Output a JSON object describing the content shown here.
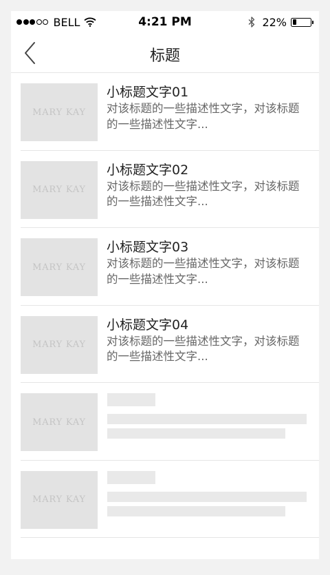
{
  "status_bar": {
    "carrier": "BELL",
    "time": "4:21 PM",
    "battery_percent": "22%",
    "battery_level": 0.22,
    "signal_bars_filled": 3,
    "signal_bars_total": 5
  },
  "nav": {
    "title": "标题",
    "back_icon": "chevron-left-icon"
  },
  "list": {
    "thumbnail_logo": "MARY KAY",
    "items": [
      {
        "title": "小标题文字01",
        "description": "对该标题的一些描述性文字，对该标题的一些描述性文字..."
      },
      {
        "title": "小标题文字02",
        "description": "对该标题的一些描述性文字，对该标题的一些描述性文字..."
      },
      {
        "title": "小标题文字03",
        "description": "对该标题的一些描述性文字，对该标题的一些描述性文字..."
      },
      {
        "title": "小标题文字04",
        "description": "对该标题的一些描述性文字，对该标题的一些描述性文字..."
      }
    ],
    "placeholder_items": 2
  },
  "colors": {
    "background": "#ffffff",
    "thumbnail": "#e3e3e3",
    "skeleton": "#e9e9e9",
    "title_text": "#222222",
    "description_text": "#666666",
    "divider": "#e5e5e5"
  }
}
